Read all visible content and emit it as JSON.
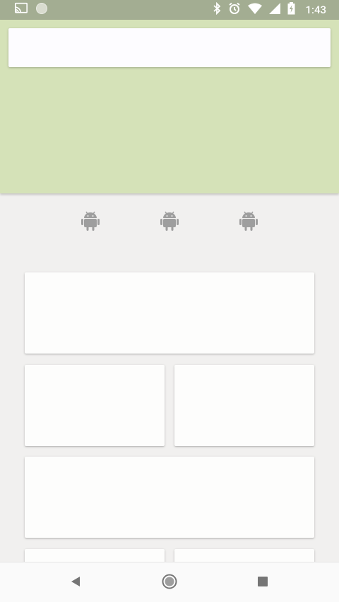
{
  "status_bar": {
    "time": "1:43",
    "icons": [
      "cast-icon",
      "circle-notification-icon",
      "bluetooth-icon",
      "alarm-icon",
      "wifi-icon",
      "signal-icon",
      "battery-icon"
    ]
  },
  "header": {
    "background_color": "#d5e2b8",
    "search_box_value": ""
  },
  "quick_icons": [
    {
      "name": "android-icon"
    },
    {
      "name": "android-icon"
    },
    {
      "name": "android-icon"
    }
  ],
  "cards": [
    {
      "kind": "wide"
    },
    {
      "kind": "half"
    },
    {
      "kind": "half"
    },
    {
      "kind": "wide"
    },
    {
      "kind": "half"
    },
    {
      "kind": "half"
    }
  ],
  "nav_bar": {
    "buttons": [
      "back-icon",
      "home-icon",
      "recents-icon"
    ]
  },
  "colors": {
    "status_bar": "#a3ad92",
    "header": "#d5e2b8",
    "page_bg": "#f1f0ef",
    "icon_gray": "#9e9e9e"
  }
}
